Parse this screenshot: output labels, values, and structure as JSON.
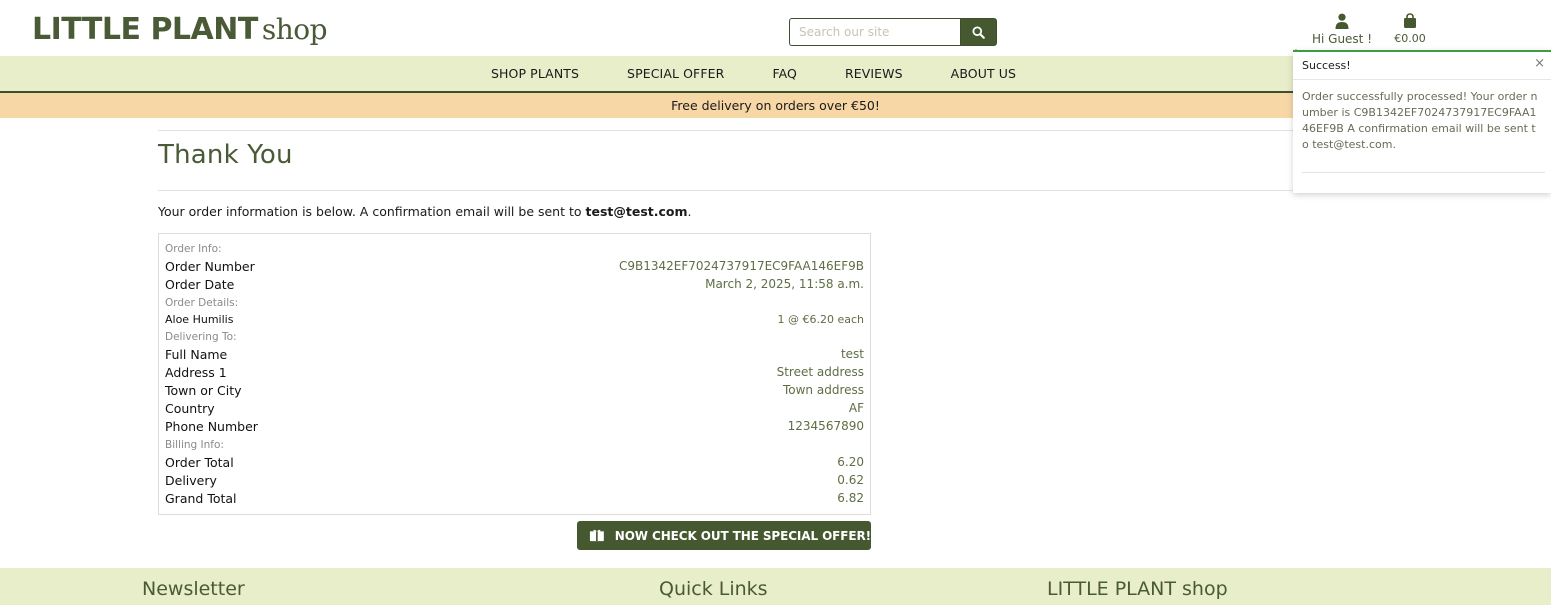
{
  "header": {
    "logo_main": "LITTLE PLANT",
    "logo_sub": "shop",
    "search_placeholder": "Search our site",
    "account_label": "Hi Guest !",
    "cart_total": "€0.00"
  },
  "nav": {
    "items": [
      {
        "label": "SHOP PLANTS"
      },
      {
        "label": "SPECIAL OFFER"
      },
      {
        "label": "FAQ"
      },
      {
        "label": "REVIEWS"
      },
      {
        "label": "ABOUT US"
      }
    ]
  },
  "promo": {
    "text": "Free delivery on orders over €50!"
  },
  "page": {
    "title": "Thank You",
    "intro_prefix": "Your order information is below. A confirmation email will be sent to ",
    "intro_email": "test@test.com",
    "intro_suffix": "."
  },
  "order": {
    "section_order_info": "Order Info:",
    "order_number_label": "Order Number",
    "order_number": "C9B1342EF7024737917EC9FAA146EF9B",
    "order_date_label": "Order Date",
    "order_date": "March 2, 2025, 11:58 a.m.",
    "section_order_details": "Order Details:",
    "item_name": "Aloe Humilis",
    "item_qty_price": "1 @ €6.20 each",
    "section_delivering": "Delivering To:",
    "full_name_label": "Full Name",
    "full_name": "test",
    "address1_label": "Address 1",
    "address1": "Street address",
    "town_label": "Town or City",
    "town": "Town address",
    "country_label": "Country",
    "country": "AF",
    "phone_label": "Phone Number",
    "phone": "1234567890",
    "section_billing": "Billing Info:",
    "order_total_label": "Order Total",
    "order_total": "6.20",
    "delivery_label": "Delivery",
    "delivery": "0.62",
    "grand_total_label": "Grand Total",
    "grand_total": "6.82"
  },
  "offer_button": {
    "label": "NOW CHECK OUT THE SPECIAL OFFER!"
  },
  "footer": {
    "col1": "Newsletter",
    "col2": "Quick Links",
    "col3": "LITTLE PLANT shop"
  },
  "toast": {
    "title": "Success!",
    "close": "×",
    "message": "Order successfully processed! Your order number is C9B1342EF7024737917EC9FAA146EF9B A confirmation email will be sent to test@test.com."
  },
  "colors": {
    "brand_green": "#46582f",
    "nav_bg": "#e8edca",
    "promo_bg": "#f7d7a6",
    "success": "#3f9b3f"
  }
}
